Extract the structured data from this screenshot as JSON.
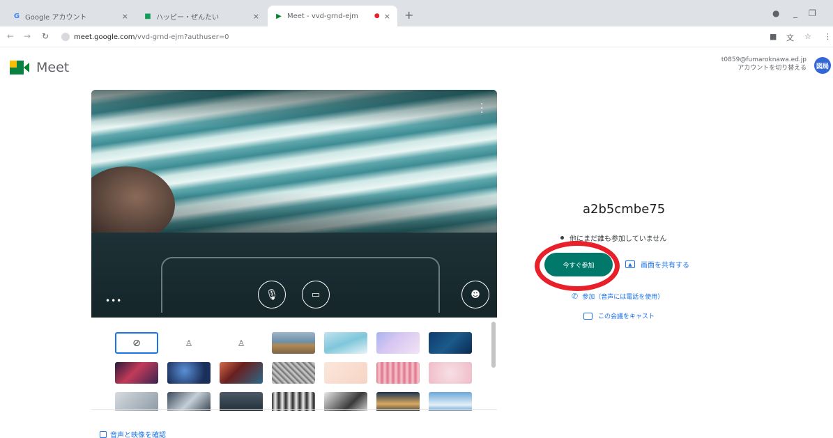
{
  "browser": {
    "tabs": [
      {
        "title": "Google アカウント",
        "favicon": "G",
        "favicon_color": "#4285f4"
      },
      {
        "title": "ハッピー・ぜんたい",
        "favicon": "■",
        "favicon_color": "#0f9d58"
      },
      {
        "title": "Meet - vvd-grnd-ejm",
        "favicon": "▶",
        "favicon_color": "#00832d"
      }
    ],
    "new_tab": "+",
    "close": "×",
    "address": {
      "host": "meet.google.com",
      "path": "/vvd-grnd-ejm?authuser=0"
    }
  },
  "meet": {
    "name": "Meet",
    "account": {
      "email": "t0859@fumaroknawa.ed.jp",
      "switch": "アカウントを切り替える",
      "avatar": "図局"
    }
  },
  "join": {
    "meeting_code": "a2b5cmbe75",
    "nobody_here": "他にまだ誰も参加していません",
    "join_button": "今すぐ参加",
    "present_button": "画面を共有する",
    "phone_audio": "参加（音声には電話を使用）",
    "cast": "この会議をキャスト"
  },
  "check_audio_video": "音声と映像を確認",
  "colors": {
    "join": "#00796b",
    "annotation": "#e8202a",
    "link": "#1a73e8"
  }
}
